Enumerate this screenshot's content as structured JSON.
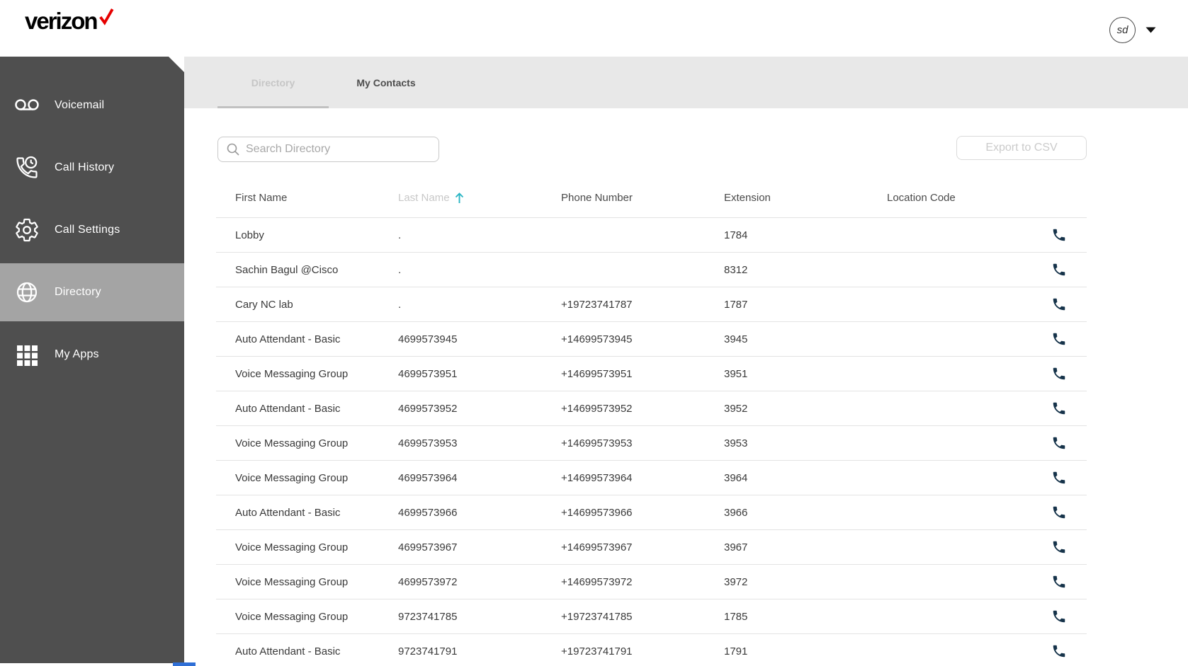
{
  "brand": {
    "logo_text": "verizon",
    "check_color": "#e60000"
  },
  "header": {
    "avatar_initials": "sd"
  },
  "sidebar": {
    "items": [
      {
        "label": "Voicemail",
        "icon": "voicemail-icon",
        "selected": false
      },
      {
        "label": "Call History",
        "icon": "call-history-icon",
        "selected": false
      },
      {
        "label": "Call Settings",
        "icon": "call-settings-icon",
        "selected": false
      },
      {
        "label": "Directory",
        "icon": "globe-icon",
        "selected": true
      },
      {
        "label": "My Apps",
        "icon": "apps-grid-icon",
        "selected": false
      }
    ]
  },
  "tabs": [
    {
      "label": "Directory",
      "active": true
    },
    {
      "label": "My Contacts",
      "active": false
    }
  ],
  "toolbar": {
    "search_placeholder": "Search Directory",
    "export_label": "Export to CSV"
  },
  "table": {
    "columns": [
      "First Name",
      "Last Name",
      "Phone Number",
      "Extension",
      "Location Code"
    ],
    "sort": {
      "column": "Last Name",
      "direction": "ascending"
    },
    "rows": [
      {
        "first_name": "Lobby",
        "last_name": ".",
        "phone_number": "",
        "extension": "1784",
        "location_code": ""
      },
      {
        "first_name": "Sachin Bagul @Cisco",
        "last_name": ".",
        "phone_number": "",
        "extension": "8312",
        "location_code": ""
      },
      {
        "first_name": "Cary NC lab",
        "last_name": ".",
        "phone_number": "+19723741787",
        "extension": "1787",
        "location_code": ""
      },
      {
        "first_name": "Auto Attendant - Basic",
        "last_name": "4699573945",
        "phone_number": "+14699573945",
        "extension": "3945",
        "location_code": ""
      },
      {
        "first_name": "Voice Messaging Group",
        "last_name": "4699573951",
        "phone_number": "+14699573951",
        "extension": "3951",
        "location_code": ""
      },
      {
        "first_name": "Auto Attendant - Basic",
        "last_name": "4699573952",
        "phone_number": "+14699573952",
        "extension": "3952",
        "location_code": ""
      },
      {
        "first_name": "Voice Messaging Group",
        "last_name": "4699573953",
        "phone_number": "+14699573953",
        "extension": "3953",
        "location_code": ""
      },
      {
        "first_name": "Voice Messaging Group",
        "last_name": "4699573964",
        "phone_number": "+14699573964",
        "extension": "3964",
        "location_code": ""
      },
      {
        "first_name": "Auto Attendant - Basic",
        "last_name": "4699573966",
        "phone_number": "+14699573966",
        "extension": "3966",
        "location_code": ""
      },
      {
        "first_name": "Voice Messaging Group",
        "last_name": "4699573967",
        "phone_number": "+14699573967",
        "extension": "3967",
        "location_code": ""
      },
      {
        "first_name": "Voice Messaging Group",
        "last_name": "4699573972",
        "phone_number": "+14699573972",
        "extension": "3972",
        "location_code": ""
      },
      {
        "first_name": "Voice Messaging Group",
        "last_name": "9723741785",
        "phone_number": "+19723741785",
        "extension": "1785",
        "location_code": ""
      },
      {
        "first_name": "Auto Attendant - Basic",
        "last_name": "9723741791",
        "phone_number": "+19723741791",
        "extension": "1791",
        "location_code": ""
      }
    ]
  },
  "colors": {
    "brand_red": "#e60000",
    "sort_arrow": "#2ab5c4",
    "phone_action_icon": "#16334a",
    "sidebar_selected": "#a4a4a4"
  }
}
